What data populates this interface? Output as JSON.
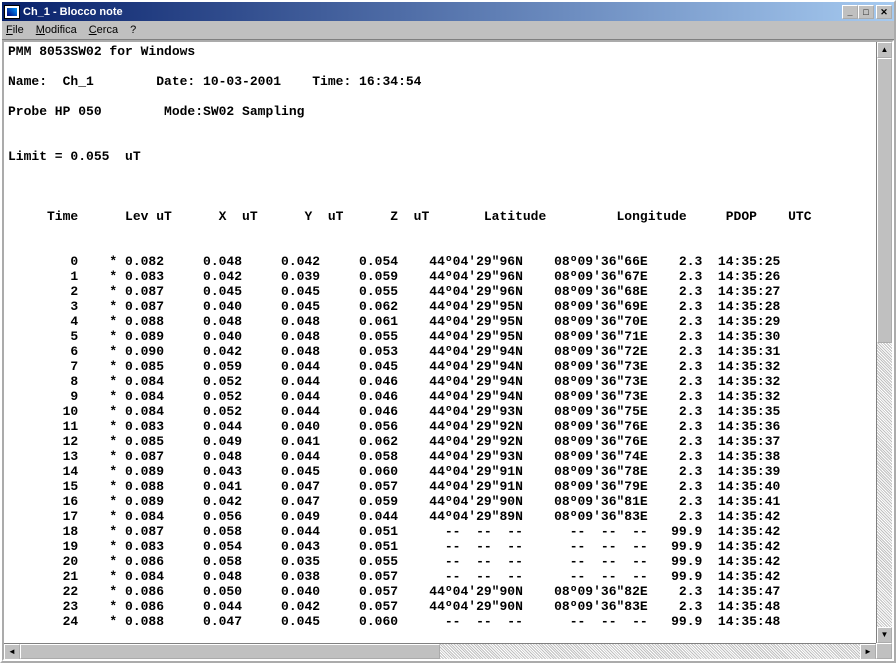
{
  "title": "Ch_1 - Blocco note",
  "menu": {
    "file": "File",
    "modifica": "Modifica",
    "cerca": "Cerca",
    "help": "?"
  },
  "header": {
    "line1": "PMM 8053SW02 for Windows",
    "name_label": "Name:",
    "name_value": "Ch_1",
    "date_label": "Date:",
    "date_value": "10-03-2001",
    "time_label": "Time:",
    "time_value": "16:34:54",
    "probe_label": "Probe",
    "probe_value": "HP 050",
    "mode_label": "Mode:",
    "mode_value": "SW02 Sampling",
    "limit_label": "Limit =",
    "limit_value": "0.055",
    "limit_unit": "uT"
  },
  "columns": {
    "time": "Time",
    "lev": "Lev",
    "levu": "uT",
    "x": "X",
    "xu": "uT",
    "y": "Y",
    "yu": "uT",
    "z": "Z",
    "zu": "uT",
    "lat": "Latitude",
    "lon": "Longitude",
    "pdop": "PDOP",
    "utc": "UTC"
  },
  "rows": [
    {
      "t": " 0",
      "lev": "0.082",
      "x": "0.048",
      "y": "0.042",
      "z": "0.054",
      "lat": "44º04'29\"96N",
      "lon": "08º09'36\"66E",
      "pdop": "  2.3",
      "utc": "14:35:25"
    },
    {
      "t": " 1",
      "lev": "0.083",
      "x": "0.042",
      "y": "0.039",
      "z": "0.059",
      "lat": "44º04'29\"96N",
      "lon": "08º09'36\"67E",
      "pdop": "  2.3",
      "utc": "14:35:26"
    },
    {
      "t": " 2",
      "lev": "0.087",
      "x": "0.045",
      "y": "0.045",
      "z": "0.055",
      "lat": "44º04'29\"96N",
      "lon": "08º09'36\"68E",
      "pdop": "  2.3",
      "utc": "14:35:27"
    },
    {
      "t": " 3",
      "lev": "0.087",
      "x": "0.040",
      "y": "0.045",
      "z": "0.062",
      "lat": "44º04'29\"95N",
      "lon": "08º09'36\"69E",
      "pdop": "  2.3",
      "utc": "14:35:28"
    },
    {
      "t": " 4",
      "lev": "0.088",
      "x": "0.048",
      "y": "0.048",
      "z": "0.061",
      "lat": "44º04'29\"95N",
      "lon": "08º09'36\"70E",
      "pdop": "  2.3",
      "utc": "14:35:29"
    },
    {
      "t": " 5",
      "lev": "0.089",
      "x": "0.040",
      "y": "0.048",
      "z": "0.055",
      "lat": "44º04'29\"95N",
      "lon": "08º09'36\"71E",
      "pdop": "  2.3",
      "utc": "14:35:30"
    },
    {
      "t": " 6",
      "lev": "0.090",
      "x": "0.042",
      "y": "0.048",
      "z": "0.053",
      "lat": "44º04'29\"94N",
      "lon": "08º09'36\"72E",
      "pdop": "  2.3",
      "utc": "14:35:31"
    },
    {
      "t": " 7",
      "lev": "0.085",
      "x": "0.059",
      "y": "0.044",
      "z": "0.045",
      "lat": "44º04'29\"94N",
      "lon": "08º09'36\"73E",
      "pdop": "  2.3",
      "utc": "14:35:32"
    },
    {
      "t": " 8",
      "lev": "0.084",
      "x": "0.052",
      "y": "0.044",
      "z": "0.046",
      "lat": "44º04'29\"94N",
      "lon": "08º09'36\"73E",
      "pdop": "  2.3",
      "utc": "14:35:32"
    },
    {
      "t": " 9",
      "lev": "0.084",
      "x": "0.052",
      "y": "0.044",
      "z": "0.046",
      "lat": "44º04'29\"94N",
      "lon": "08º09'36\"73E",
      "pdop": "  2.3",
      "utc": "14:35:32"
    },
    {
      "t": "10",
      "lev": "0.084",
      "x": "0.052",
      "y": "0.044",
      "z": "0.046",
      "lat": "44º04'29\"93N",
      "lon": "08º09'36\"75E",
      "pdop": "  2.3",
      "utc": "14:35:35"
    },
    {
      "t": "11",
      "lev": "0.083",
      "x": "0.044",
      "y": "0.040",
      "z": "0.056",
      "lat": "44º04'29\"92N",
      "lon": "08º09'36\"76E",
      "pdop": "  2.3",
      "utc": "14:35:36"
    },
    {
      "t": "12",
      "lev": "0.085",
      "x": "0.049",
      "y": "0.041",
      "z": "0.062",
      "lat": "44º04'29\"92N",
      "lon": "08º09'36\"76E",
      "pdop": "  2.3",
      "utc": "14:35:37"
    },
    {
      "t": "13",
      "lev": "0.087",
      "x": "0.048",
      "y": "0.044",
      "z": "0.058",
      "lat": "44º04'29\"93N",
      "lon": "08º09'36\"74E",
      "pdop": "  2.3",
      "utc": "14:35:38"
    },
    {
      "t": "14",
      "lev": "0.089",
      "x": "0.043",
      "y": "0.045",
      "z": "0.060",
      "lat": "44º04'29\"91N",
      "lon": "08º09'36\"78E",
      "pdop": "  2.3",
      "utc": "14:35:39"
    },
    {
      "t": "15",
      "lev": "0.088",
      "x": "0.041",
      "y": "0.047",
      "z": "0.057",
      "lat": "44º04'29\"91N",
      "lon": "08º09'36\"79E",
      "pdop": "  2.3",
      "utc": "14:35:40"
    },
    {
      "t": "16",
      "lev": "0.089",
      "x": "0.042",
      "y": "0.047",
      "z": "0.059",
      "lat": "44º04'29\"90N",
      "lon": "08º09'36\"81E",
      "pdop": "  2.3",
      "utc": "14:35:41"
    },
    {
      "t": "17",
      "lev": "0.084",
      "x": "0.056",
      "y": "0.049",
      "z": "0.044",
      "lat": "44º04'29\"89N",
      "lon": "08º09'36\"83E",
      "pdop": "  2.3",
      "utc": "14:35:42"
    },
    {
      "t": "18",
      "lev": "0.087",
      "x": "0.058",
      "y": "0.044",
      "z": "0.051",
      "lat": "  --  --  --",
      "lon": "  --  --  --",
      "pdop": " 99.9",
      "utc": "14:35:42"
    },
    {
      "t": "19",
      "lev": "0.083",
      "x": "0.054",
      "y": "0.043",
      "z": "0.051",
      "lat": "  --  --  --",
      "lon": "  --  --  --",
      "pdop": " 99.9",
      "utc": "14:35:42"
    },
    {
      "t": "20",
      "lev": "0.086",
      "x": "0.058",
      "y": "0.035",
      "z": "0.055",
      "lat": "  --  --  --",
      "lon": "  --  --  --",
      "pdop": " 99.9",
      "utc": "14:35:42"
    },
    {
      "t": "21",
      "lev": "0.084",
      "x": "0.048",
      "y": "0.038",
      "z": "0.057",
      "lat": "  --  --  --",
      "lon": "  --  --  --",
      "pdop": " 99.9",
      "utc": "14:35:42"
    },
    {
      "t": "22",
      "lev": "0.086",
      "x": "0.050",
      "y": "0.040",
      "z": "0.057",
      "lat": "44º04'29\"90N",
      "lon": "08º09'36\"82E",
      "pdop": "  2.3",
      "utc": "14:35:47"
    },
    {
      "t": "23",
      "lev": "0.086",
      "x": "0.044",
      "y": "0.042",
      "z": "0.057",
      "lat": "44º04'29\"90N",
      "lon": "08º09'36\"83E",
      "pdop": "  2.3",
      "utc": "14:35:48"
    },
    {
      "t": "24",
      "lev": "0.088",
      "x": "0.047",
      "y": "0.045",
      "z": "0.060",
      "lat": "  --  --  --",
      "lon": "  --  --  --",
      "pdop": " 99.9",
      "utc": "14:35:48"
    }
  ]
}
